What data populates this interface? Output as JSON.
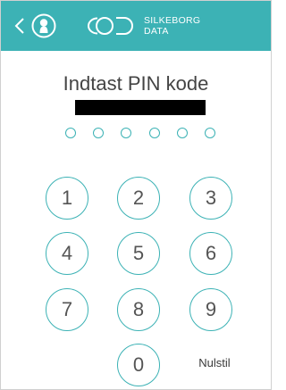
{
  "header": {
    "brand_line1": "SILKEBORG",
    "brand_line2": "DATA",
    "background_color": "#3cb2b5",
    "back_icon": "chevron-left-icon",
    "profile_icon": "person-circle-icon",
    "logo_icon": "cod-logo-icon"
  },
  "pin": {
    "title": "Indtast PIN kode",
    "digits_entered": 0,
    "digits_total": 6
  },
  "keypad": {
    "keys": [
      "1",
      "2",
      "3",
      "4",
      "5",
      "6",
      "7",
      "8",
      "9",
      "0"
    ],
    "reset_label": "Nulstil"
  },
  "colors": {
    "accent": "#3cb2b5",
    "text": "#444444"
  }
}
